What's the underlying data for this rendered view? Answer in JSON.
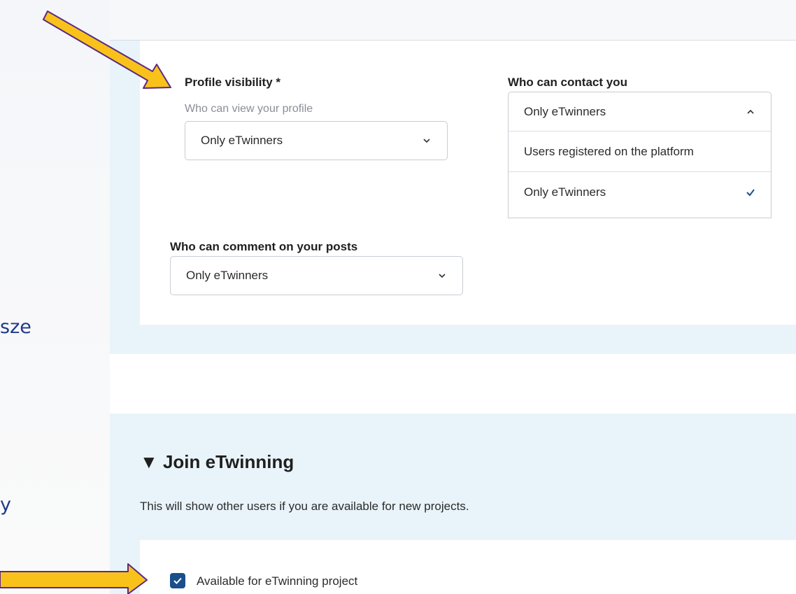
{
  "left_fragments": [
    "sze",
    "y"
  ],
  "privacy": {
    "profile_visibility": {
      "label": "Profile visibility *",
      "hint": "Who can view your profile",
      "value": "Only eTwinners"
    },
    "contact": {
      "label": "Who can contact you",
      "value": "Only eTwinners",
      "options": [
        "Users registered on the platform",
        "Only eTwinners"
      ],
      "selected": "Only eTwinners"
    },
    "comments": {
      "label": "Who can comment on your posts",
      "value": "Only eTwinners"
    }
  },
  "join": {
    "heading": "▼ Join eTwinning",
    "description": "This will show other users if you are available for new projects.",
    "checkbox_label": "Available for eTwinning project",
    "checked": true
  },
  "colors": {
    "section_bg": "#e9f4fa",
    "checkbox": "#1a4f8b",
    "arrow_fill": "#f9c21a",
    "arrow_stroke": "#5b2a86",
    "left_text": "#1f3a8a"
  },
  "icons": [
    "chevron-down-icon",
    "chevron-up-icon",
    "check-icon",
    "arrow-annotation"
  ]
}
